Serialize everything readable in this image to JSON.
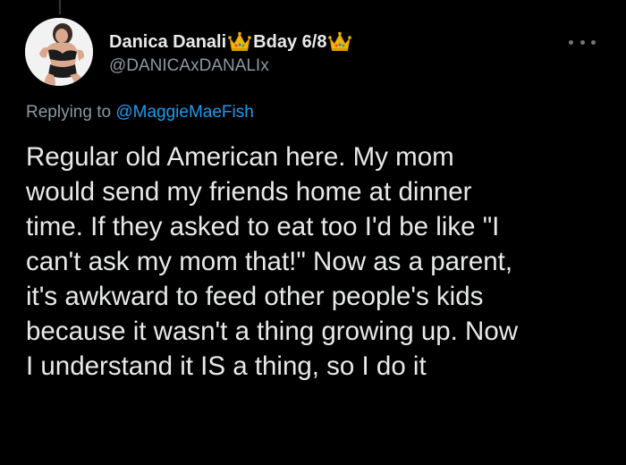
{
  "tweet": {
    "author": {
      "display_name": "Danica Danali",
      "birthday_text": "Bday 6/8",
      "name_emoji": "crown-icon",
      "handle": "@DANICAxDANALIx",
      "avatar": "profile-photo"
    },
    "more_icon": "more-horizontal-icon",
    "reply": {
      "prefix": "Replying to",
      "mention": "@MaggieMaeFish"
    },
    "text_lines": [
      "Regular old American here. My mom",
      "would send my friends home at dinner",
      "time. If they asked to eat too I'd be like \"I",
      "can't ask my mom that!\" Now as a parent,",
      "it's awkward to feed other people's kids",
      "because it wasn't a thing growing up. Now",
      "I understand it IS a thing, so I do it"
    ]
  },
  "colors": {
    "background": "#000000",
    "primary_text": "#e7e9ea",
    "secondary_text": "#8b98a5",
    "link": "#1d9bf0",
    "crown_gold": "#f4b400"
  }
}
